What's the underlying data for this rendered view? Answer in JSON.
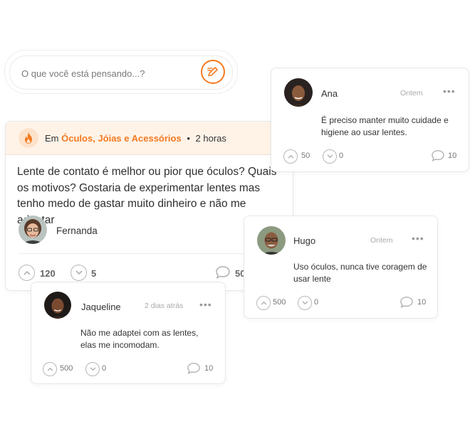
{
  "composer": {
    "placeholder": "O que você está pensando...?"
  },
  "post": {
    "category_prefix": "Em",
    "category": "Óculos, Jóias e Acessórios",
    "separator": "•",
    "time": "2 horas",
    "text": "Lente de contato é melhor ou pior que óculos? Quais os motivos? Gostaria de experimentar lentes mas tenho medo de gastar muito dinheiro e não me adaptar",
    "author": "Fernanda",
    "upvotes": "120",
    "downvotes": "5",
    "comments": "50"
  },
  "comments": [
    {
      "name": "Ana",
      "time": "Ontem",
      "menu": "•••",
      "text": "É preciso manter muito cuidade e higiene ao usar lentes.",
      "upvotes": "50",
      "downvotes": "0",
      "replies": "10"
    },
    {
      "name": "Hugo",
      "time": "Ontem",
      "menu": "•••",
      "text": "Uso óculos, nunca tive coragem de usar lente",
      "upvotes": "500",
      "downvotes": "0",
      "replies": "10"
    },
    {
      "name": "Jaqueline",
      "time": "2 dias atrás",
      "menu": "•••",
      "text": "Não me adaptei com as lentes, elas me incomodam.",
      "upvotes": "500",
      "downvotes": "0",
      "replies": "10"
    }
  ],
  "colors": {
    "accent": "#f47a20",
    "header_bg": "#fff3e8"
  }
}
